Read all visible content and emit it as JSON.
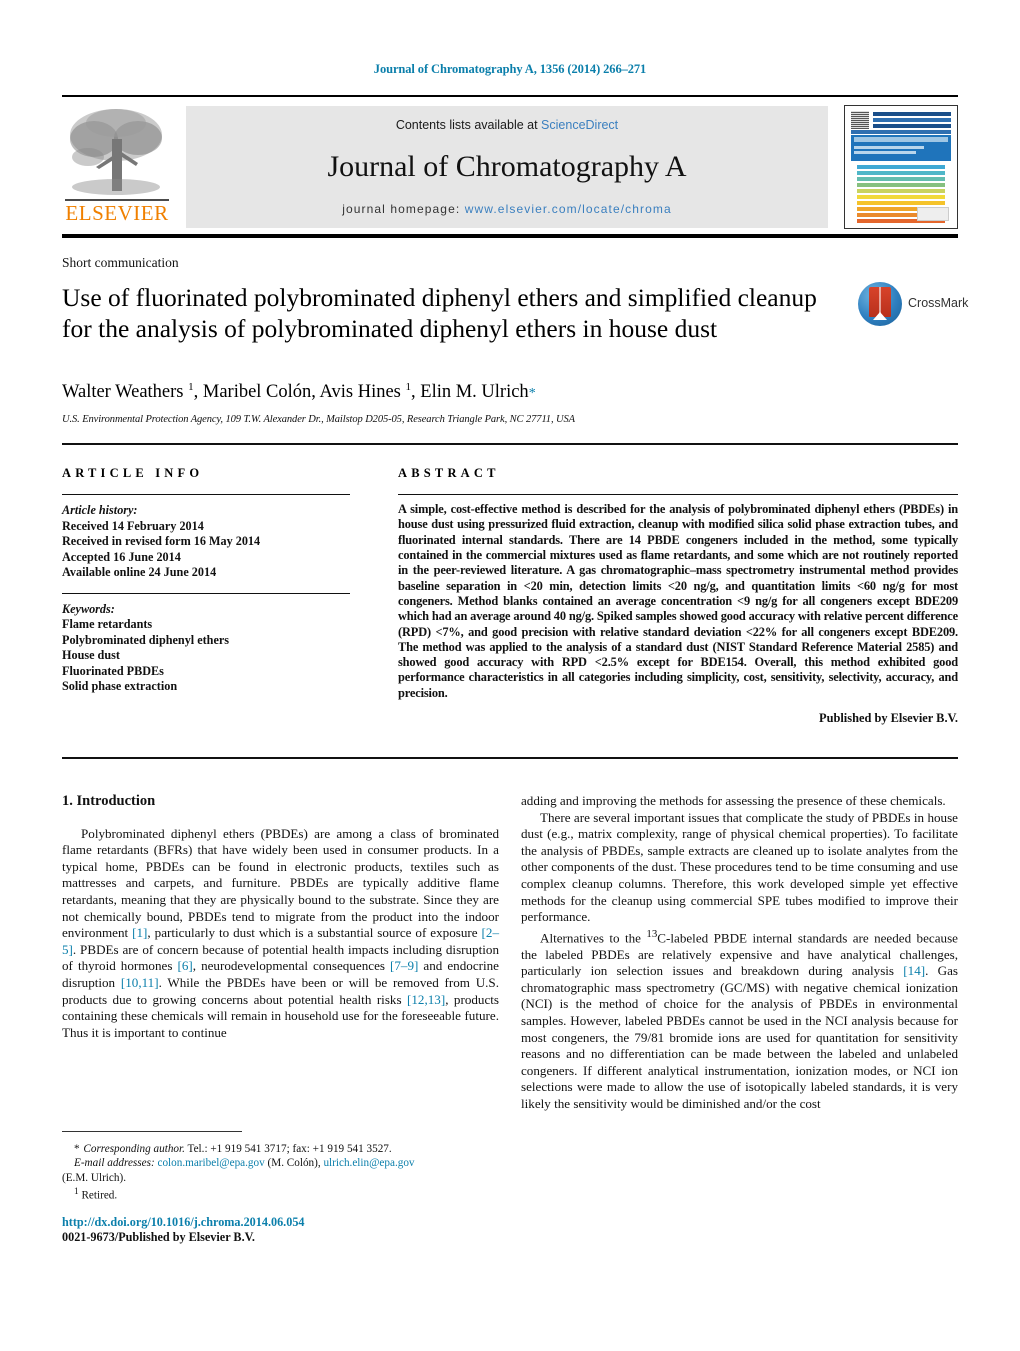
{
  "running_head": "Journal of Chromatography A, 1356 (2014) 266–271",
  "masthead": {
    "contents_line_prefix": "Contents lists available at ",
    "sciencedirect": "ScienceDirect",
    "journal_title": "Journal of Chromatography A",
    "homepage_label": "journal homepage:",
    "homepage_url": "www.elsevier.com/locate/chroma",
    "publisher_logo_text": "ELSEVIER"
  },
  "article_type": "Short communication",
  "title": "Use of fluorinated polybrominated diphenyl ethers and simplified cleanup for the analysis of polybrominated diphenyl ethers in house dust",
  "crossmark_label": "CrossMark",
  "authors_html": "Walter Weathers <sup>1</sup>, Maribel Colón, Avis Hines <sup>1</sup>, Elin M. Ulrich<span class=\"star\">*</span>",
  "affiliation": "U.S. Environmental Protection Agency, 109 T.W. Alexander Dr., Mailstop D205-05, Research Triangle Park, NC 27711, USA",
  "article_info": {
    "heading": "ARTICLE INFO",
    "history_label": "Article history:",
    "history": [
      "Received 14 February 2014",
      "Received in revised form 16 May 2014",
      "Accepted 16 June 2014",
      "Available online 24 June 2014"
    ],
    "keywords_label": "Keywords:",
    "keywords": [
      "Flame retardants",
      "Polybrominated diphenyl ethers",
      "House dust",
      "Fluorinated PBDEs",
      "Solid phase extraction"
    ]
  },
  "abstract": {
    "heading": "ABSTRACT",
    "text": "A simple, cost-effective method is described for the analysis of polybrominated diphenyl ethers (PBDEs) in house dust using pressurized fluid extraction, cleanup with modified silica solid phase extraction tubes, and fluorinated internal standards. There are 14 PBDE congeners included in the method, some typically contained in the commercial mixtures used as flame retardants, and some which are not routinely reported in the peer-reviewed literature. A gas chromatographic–mass spectrometry instrumental method provides baseline separation in <20 min, detection limits <20 ng/g, and quantitation limits <60 ng/g for most congeners. Method blanks contained an average concentration <9 ng/g for all congeners except BDE209 which had an average around 40 ng/g. Spiked samples showed good accuracy with relative percent difference (RPD) <7%, and good precision with relative standard deviation <22% for all congeners except BDE209. The method was applied to the analysis of a standard dust (NIST Standard Reference Material 2585) and showed good accuracy with RPD <2.5% except for BDE154. Overall, this method exhibited good performance characteristics in all categories including simplicity, cost, sensitivity, selectivity, accuracy, and precision.",
    "published_by": "Published by Elsevier B.V."
  },
  "introduction": {
    "heading": "1. Introduction",
    "left_paragraph_html": "Polybrominated diphenyl ethers (PBDEs) are among a class of brominated flame retardants (BFRs) that have widely been used in consumer products. In a typical home, PBDEs can be found in electronic products, textiles such as mattresses and carpets, and furniture. PBDEs are typically additive flame retardants, meaning that they are physically bound to the substrate. Since they are not chemically bound, PBDEs tend to migrate from the product into the indoor environment <span class=\"ref\">[1]</span>, particularly to dust which is a substantial source of exposure <span class=\"ref\">[2–5]</span>. PBDEs are of concern because of potential health impacts including disruption of thyroid hormones <span class=\"ref\">[6]</span>, neurodevelopmental consequences <span class=\"ref\">[7–9]</span> and endocrine disruption <span class=\"ref\">[10,11]</span>. While the PBDEs have been or will be removed from U.S. products due to growing concerns about potential health risks <span class=\"ref\">[12,13]</span>, products containing these chemicals will remain in household use for the foreseeable future. Thus it is important to continue",
    "right_paragraph_1_html": "adding and improving the methods for assessing the presence of these chemicals.",
    "right_paragraph_2_html": "There are several important issues that complicate the study of PBDEs in house dust (e.g., matrix complexity, range of physical chemical properties). To facilitate the analysis of PBDEs, sample extracts are cleaned up to isolate analytes from the other components of the dust. These procedures tend to be time consuming and use complex cleanup columns. Therefore, this work developed simple yet effective methods for the cleanup using commercial SPE tubes modified to improve their performance.",
    "right_paragraph_3_html": "Alternatives to the <sup>13</sup>C-labeled PBDE internal standards are needed because the labeled PBDEs are relatively expensive and have analytical challenges, particularly ion selection issues and breakdown during analysis <span class=\"ref\">[14]</span>. Gas chromatographic mass spectrometry (GC/MS) with negative chemical ionization (NCI) is the method of choice for the analysis of PBDEs in environmental samples. However, labeled PBDEs cannot be used in the NCI analysis because for most congeners, the 79/81 bromide ions are used for quantitation for sensitivity reasons and no differentiation can be made between the labeled and unlabeled congeners. If different analytical instrumentation, ionization modes, or NCI ion selections were made to allow the use of isotopically labeled standards, it is very likely the sensitivity would be diminished and/or the cost"
  },
  "footnotes": {
    "corresponding_html": "<span style=\"letter-spacing:1px\">*</span> <span class=\"ital\">Corresponding author.</span> Tel.: +1 919 541 3717; fax: +1 919 541 3527.",
    "emails_html": "<span class=\"ital\">E-mail addresses:</span> <span class=\"mail\">colon.maribel@epa.gov</span> (M. Colón), <span class=\"mail\">ulrich.elin@epa.gov</span>",
    "emails_cont": "(E.M. Ulrich).",
    "retired_html": "<sup>1</sup> Retired."
  },
  "doi": "http://dx.doi.org/10.1016/j.chroma.2014.06.054",
  "issn_line": "0021-9673/Published by Elsevier B.V.",
  "colors": {
    "link_blue": "#0b7fab",
    "sciencedirect_blue": "#3a7fbf",
    "elsevier_orange": "#f08000",
    "grey_box": "#e6e6e6"
  }
}
